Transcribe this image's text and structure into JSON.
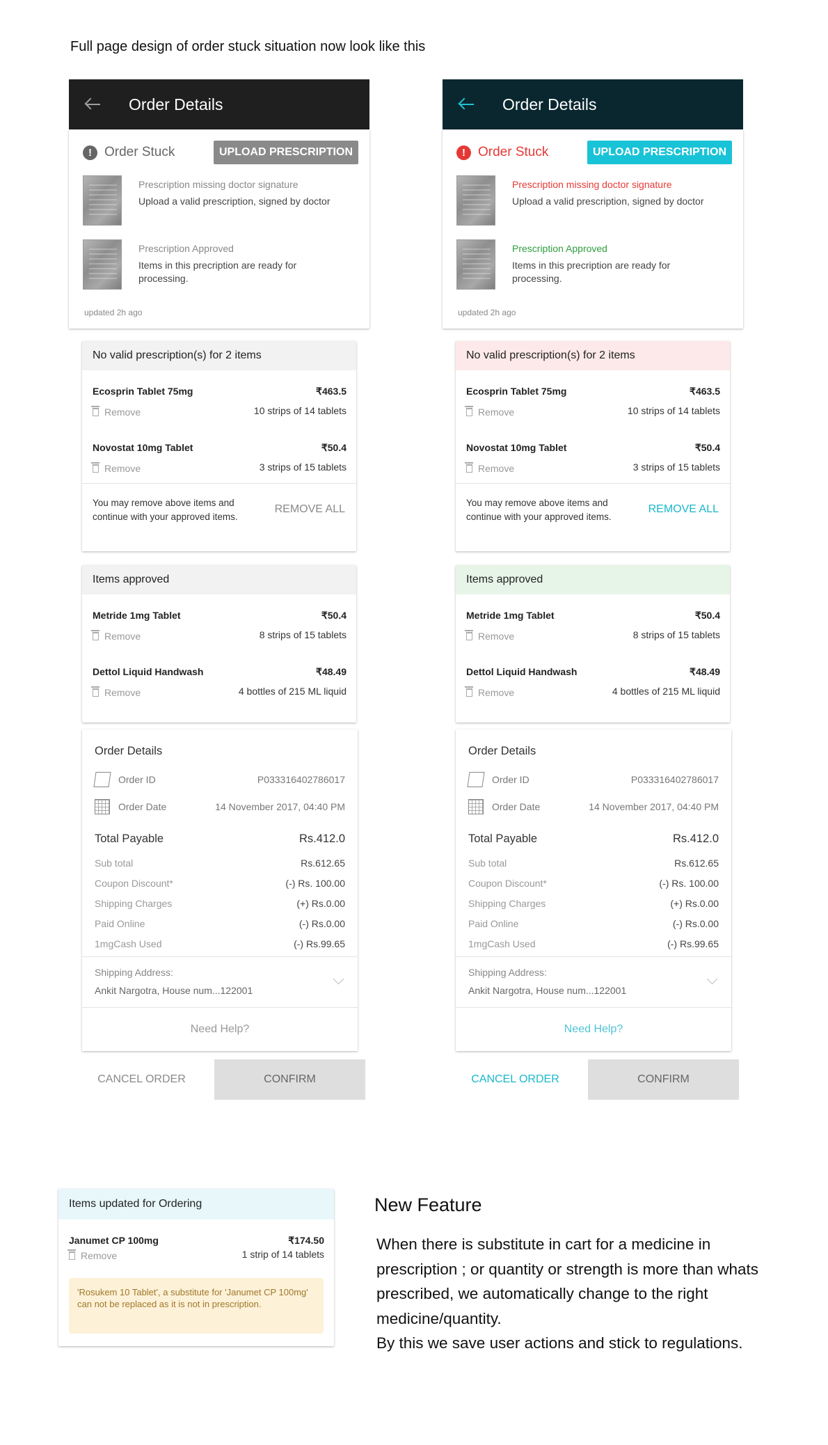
{
  "intro": "Full page design of order stuck situation now look like this",
  "header": {
    "title": "Order Details"
  },
  "stuck": {
    "status": "Order Stuck",
    "upload_label": "UPLOAD PRESCRIPTION",
    "rx1_title": "Prescription missing doctor signature",
    "rx1_desc": "Upload a valid prescription, signed by doctor",
    "rx2_title": "Prescription Approved",
    "rx2_desc": "Items in this precription are ready for processing.",
    "updated": "updated 2h ago"
  },
  "invalid": {
    "header": "No valid prescription(s) for 2 items",
    "items": [
      {
        "name": "Ecosprin Tablet 75mg",
        "price": "₹463.5",
        "qty": "10 strips of 14 tablets",
        "remove": "Remove"
      },
      {
        "name": "Novostat 10mg Tablet",
        "price": "₹50.4",
        "qty": "3 strips of 15 tablets",
        "remove": "Remove"
      }
    ],
    "footer_text": "You may remove above items and continue with your approved items.",
    "remove_all": "REMOVE ALL"
  },
  "approved": {
    "header": "Items approved",
    "items": [
      {
        "name": "Metride 1mg Tablet",
        "price": "₹50.4",
        "qty": "8 strips of 15 tablets",
        "remove": "Remove"
      },
      {
        "name": "Dettol Liquid Handwash",
        "price": "₹48.49",
        "qty": "4 bottles of 215 ML liquid",
        "remove": "Remove"
      }
    ]
  },
  "order": {
    "title": "Order Details",
    "id_label": "Order ID",
    "id_value": "P033316402786017",
    "date_label": "Order Date",
    "date_value": "14 November 2017, 04:40 PM",
    "total_label": "Total Payable",
    "total_value": "Rs.412.0",
    "rows": [
      {
        "label": "Sub total",
        "value": "Rs.612.65"
      },
      {
        "label": "Coupon Discount*",
        "value": "(-) Rs. 100.00"
      },
      {
        "label": "Shipping Charges",
        "value": "(+) Rs.0.00"
      },
      {
        "label": "Paid Online",
        "value": "(-) Rs.0.00"
      },
      {
        "label": "1mgCash Used",
        "value": "(-) Rs.99.65"
      }
    ],
    "ship_label": "Shipping Address:",
    "ship_value": "Ankit Nargotra, House num...122001",
    "help": "Need Help?"
  },
  "buttons": {
    "cancel": "CANCEL ORDER",
    "confirm": "CONFIRM"
  },
  "new_feature": {
    "card_header": "Items updated for Ordering",
    "item": {
      "name": "Janumet CP 100mg",
      "price": "₹174.50",
      "qty": "1 strip of 14 tablets",
      "remove": "Remove"
    },
    "note": "'Rosukem 10 Tablet', a substitute for 'Janumet CP 100mg' can not be replaced as it is not in prescription.",
    "title": "New Feature",
    "text": "When there is substitute in cart for a medicine in prescription ; or quantity or strength is more than whats prescribed, we automatically change to the right medicine/quantity.\nBy this we save user actions and stick to regulations."
  },
  "colors": {
    "cyan": "#19c3d7",
    "red": "#e53935",
    "green": "#2e9e3e",
    "dark_header": "#0a2730"
  }
}
